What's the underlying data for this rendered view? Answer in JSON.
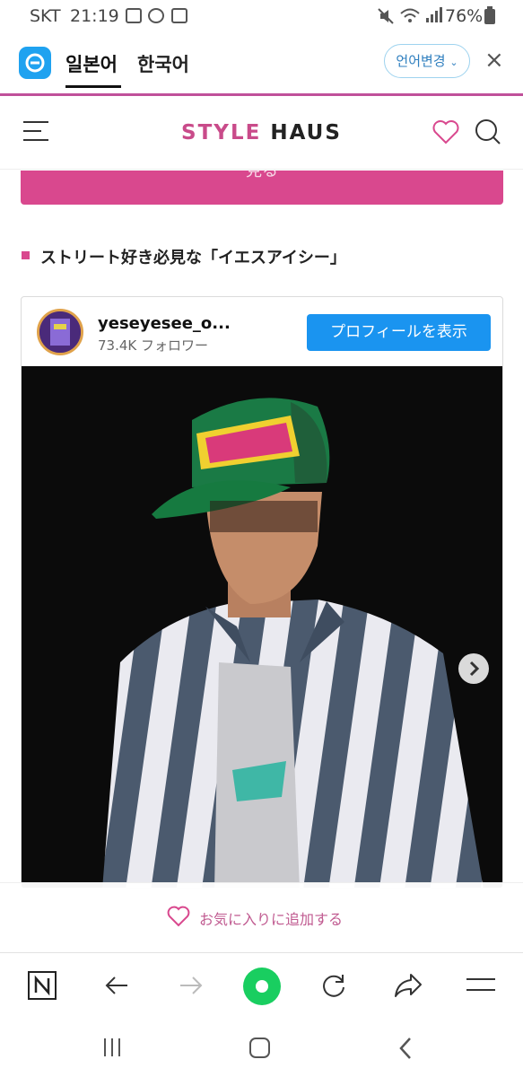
{
  "status_bar": {
    "carrier": "SKT",
    "time": "21:19",
    "battery": "76%"
  },
  "translate_bar": {
    "source_lang": "일본어",
    "target_lang": "한국어",
    "change_lang_label": "언어변경",
    "close_label": "×"
  },
  "site_header": {
    "brand_part1": "STYLE",
    "brand_part2": "HAUS"
  },
  "pink_button": {
    "label": "見る"
  },
  "section": {
    "title": "ストリート好き必見な「イエスアイシー」"
  },
  "instagram": {
    "username": "yeseyesee_o...",
    "followers": "73.4K フォロワー",
    "profile_button": "プロフィールを表示"
  },
  "favorite": {
    "label": "お気に入りに追加する"
  },
  "colors": {
    "brand_pink": "#d9488e",
    "instagram_blue": "#1a94f0",
    "naver_green": "#19ce60"
  }
}
